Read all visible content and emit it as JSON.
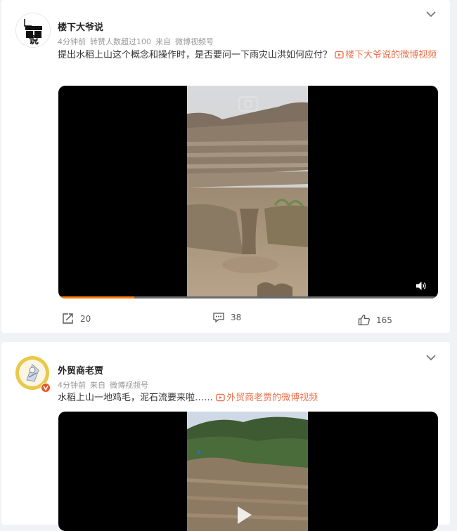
{
  "posts": [
    {
      "author": "楼下大爷说",
      "avatar_text": "说",
      "meta": [
        "4分钟前",
        "转赞人数超过100",
        "来自",
        "微博视频号"
      ],
      "text": "提出水稻上山这个概念和操作时，是否要问一下雨灾山洪如何应付？",
      "video_link": "楼下大爷说的微博视频",
      "video": {
        "progress": 0.2,
        "sound": "volume-icon"
      },
      "actions": {
        "repost": "20",
        "comment": "38",
        "like": "165"
      }
    },
    {
      "author": "外贸商老贾",
      "meta": [
        "4分钟前",
        "来自",
        "微博视频号"
      ],
      "text": "水稻上山一地鸡毛，泥石流要来啦……",
      "video_link": "外贸商老贾的微博视频"
    }
  ],
  "colors": {
    "link": "#eb7350",
    "progress": "#ff7a12",
    "verified": "#e8542a"
  }
}
